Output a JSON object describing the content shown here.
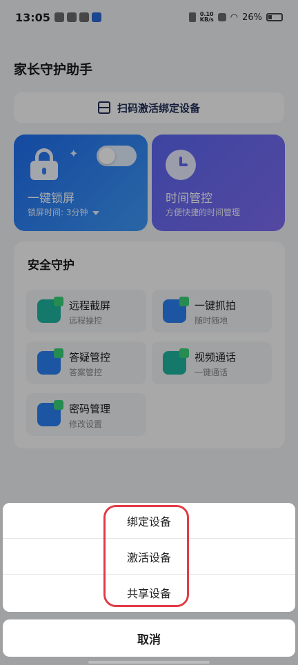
{
  "status_bar": {
    "time": "13:05",
    "net_speed_top": "0.10",
    "net_speed_bottom": "KB/s",
    "battery": "26%"
  },
  "page": {
    "title": "家长守护助手",
    "scan_label": "扫码激活绑定设备"
  },
  "cards": {
    "lock": {
      "title": "一键锁屏",
      "subtitle": "锁屏时间: 3分钟"
    },
    "time": {
      "title": "时间管控",
      "subtitle": "方便快捷的时间管理"
    }
  },
  "safety": {
    "title": "安全守护",
    "tiles": [
      {
        "title": "远程截屏",
        "subtitle": "远程操控"
      },
      {
        "title": "一键抓拍",
        "subtitle": "随时随地"
      },
      {
        "title": "答疑管控",
        "subtitle": "答案管控"
      },
      {
        "title": "视频通话",
        "subtitle": "一键通话"
      },
      {
        "title": "密码管理",
        "subtitle": "修改设置"
      }
    ]
  },
  "sheet": {
    "options": [
      "绑定设备",
      "激活设备",
      "共享设备"
    ],
    "cancel_label": "取消"
  },
  "colors": {
    "annotation": "#e23b45",
    "card_blue": "#2a7ff0",
    "card_purple": "#6a6af1"
  }
}
